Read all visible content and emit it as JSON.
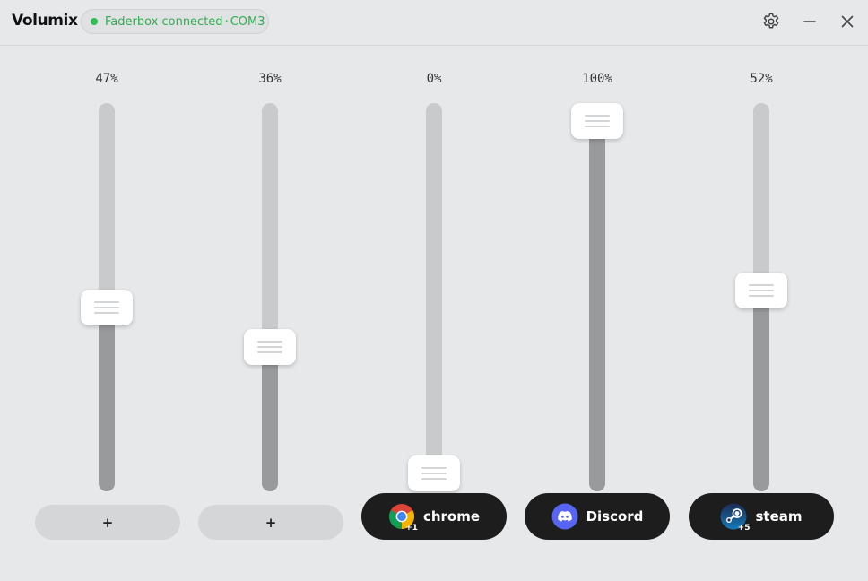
{
  "app": {
    "title": "Volumix",
    "status": {
      "text": "Faderbox connected",
      "separator": "·",
      "port": "COM3",
      "color": "#2dbf55"
    }
  },
  "window_controls": [
    "gear-icon",
    "minimize-icon",
    "close-icon"
  ],
  "channels": [
    {
      "percent_label": "47%",
      "level": 0.47,
      "button_label": "+",
      "assigned": false
    },
    {
      "percent_label": "36%",
      "level": 0.36,
      "button_label": "+",
      "assigned": false
    },
    {
      "percent_label": "0%",
      "level": 0.0,
      "button_label": "chrome",
      "assigned": true,
      "icon": "chrome-icon",
      "extra": "+1"
    },
    {
      "percent_label": "100%",
      "level": 1.0,
      "button_label": "Discord",
      "assigned": true,
      "icon": "discord-icon"
    },
    {
      "percent_label": "52%",
      "level": 0.52,
      "button_label": "steam",
      "assigned": true,
      "icon": "steam-icon",
      "extra": "+5"
    }
  ],
  "colors": {
    "background": "#e7e8ea",
    "track": "#c9cacb",
    "fill": "#999a9b",
    "app_button": "#1d1d1d",
    "assign_button": "#d5d6d7"
  }
}
